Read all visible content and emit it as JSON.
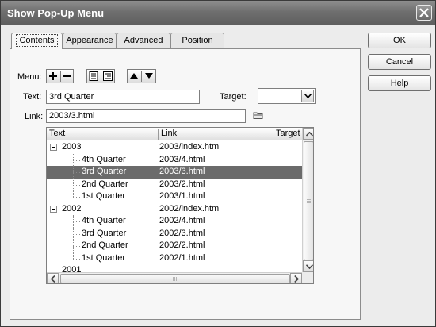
{
  "window": {
    "title": "Show Pop-Up Menu"
  },
  "tabs": [
    {
      "label": "Contents",
      "active": true
    },
    {
      "label": "Appearance",
      "active": false
    },
    {
      "label": "Advanced",
      "active": false
    },
    {
      "label": "Position",
      "active": false
    }
  ],
  "buttons": {
    "ok": "OK",
    "cancel": "Cancel",
    "help": "Help"
  },
  "form": {
    "menu_label": "Menu:",
    "text_label": "Text:",
    "text_value": "3rd Quarter",
    "target_label": "Target:",
    "target_value": "",
    "link_label": "Link:",
    "link_value": "2003/3.html"
  },
  "tree": {
    "columns": [
      "Text",
      "Link",
      "Target"
    ],
    "rows": [
      {
        "text": "2003",
        "link": "2003/index.html",
        "level": 0,
        "expanded": true,
        "selected": false
      },
      {
        "text": "4th Quarter",
        "link": "2003/4.html",
        "level": 1,
        "selected": false
      },
      {
        "text": "3rd Quarter",
        "link": "2003/3.html",
        "level": 1,
        "selected": true
      },
      {
        "text": "2nd Quarter",
        "link": "2003/2.html",
        "level": 1,
        "selected": false
      },
      {
        "text": "1st Quarter",
        "link": "2003/1.html",
        "level": 1,
        "selected": false
      },
      {
        "text": "2002",
        "link": "2002/index.html",
        "level": 0,
        "expanded": true,
        "selected": false
      },
      {
        "text": "4th Quarter",
        "link": "2002/4.html",
        "level": 1,
        "selected": false
      },
      {
        "text": "3rd Quarter",
        "link": "2002/3.html",
        "level": 1,
        "selected": false
      },
      {
        "text": "2nd Quarter",
        "link": "2002/2.html",
        "level": 1,
        "selected": false
      },
      {
        "text": "1st Quarter",
        "link": "2002/1.html",
        "level": 1,
        "selected": false
      },
      {
        "text": "2001",
        "link": "",
        "level": 0,
        "selected": false
      }
    ]
  },
  "icons": {
    "close": "close-icon",
    "add": "plus-icon",
    "remove": "minus-icon",
    "indent": "indent-icon",
    "outdent": "outdent-icon",
    "move_up": "triangle-up-icon",
    "move_down": "triangle-down-icon",
    "browse": "folder-icon"
  },
  "colors": {
    "selection": "#6b6b6b",
    "titlebar": "#6f6f6f"
  }
}
